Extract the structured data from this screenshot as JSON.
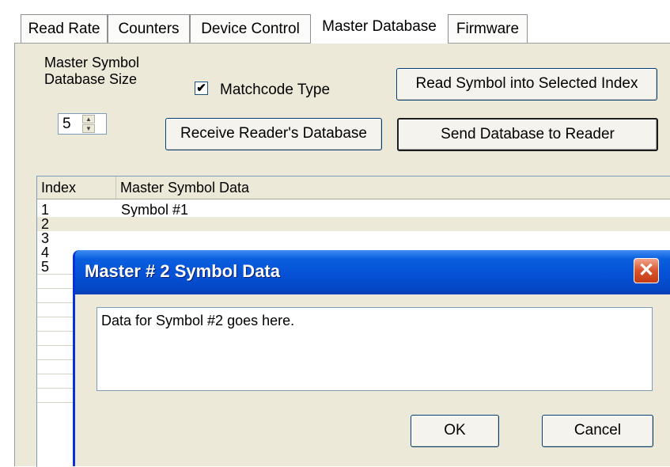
{
  "tabs": [
    "Read Rate",
    "Counters",
    "Device Control",
    "Master Database",
    "Firmware"
  ],
  "active_tab": "Master Database",
  "panel": {
    "size_label_line1": "Master Symbol",
    "size_label_line2": "Database Size",
    "size_value": "5",
    "matchcode_label": "Matchcode Type",
    "matchcode_checked": "✔",
    "read_symbol_button": "Read Symbol into Selected Index",
    "receive_button": "Receive Reader's Database",
    "send_button": "Send Database to Reader"
  },
  "table": {
    "columns": [
      "Index",
      "Master Symbol Data"
    ],
    "rows": [
      {
        "index": "1",
        "data": "Symbol #1"
      },
      {
        "index": "2",
        "data": ""
      },
      {
        "index": "3",
        "data": ""
      },
      {
        "index": "4",
        "data": ""
      },
      {
        "index": "5",
        "data": ""
      }
    ]
  },
  "dialog": {
    "title": "Master # 2 Symbol Data",
    "close_glyph": "✕",
    "text_value": "Data for Symbol #2 goes here.",
    "ok_label": "OK",
    "cancel_label": "Cancel"
  },
  "colors": {
    "titlebar": "#0551d6",
    "panel_bg": "#ece9d8",
    "close_button": "#d9542c"
  }
}
